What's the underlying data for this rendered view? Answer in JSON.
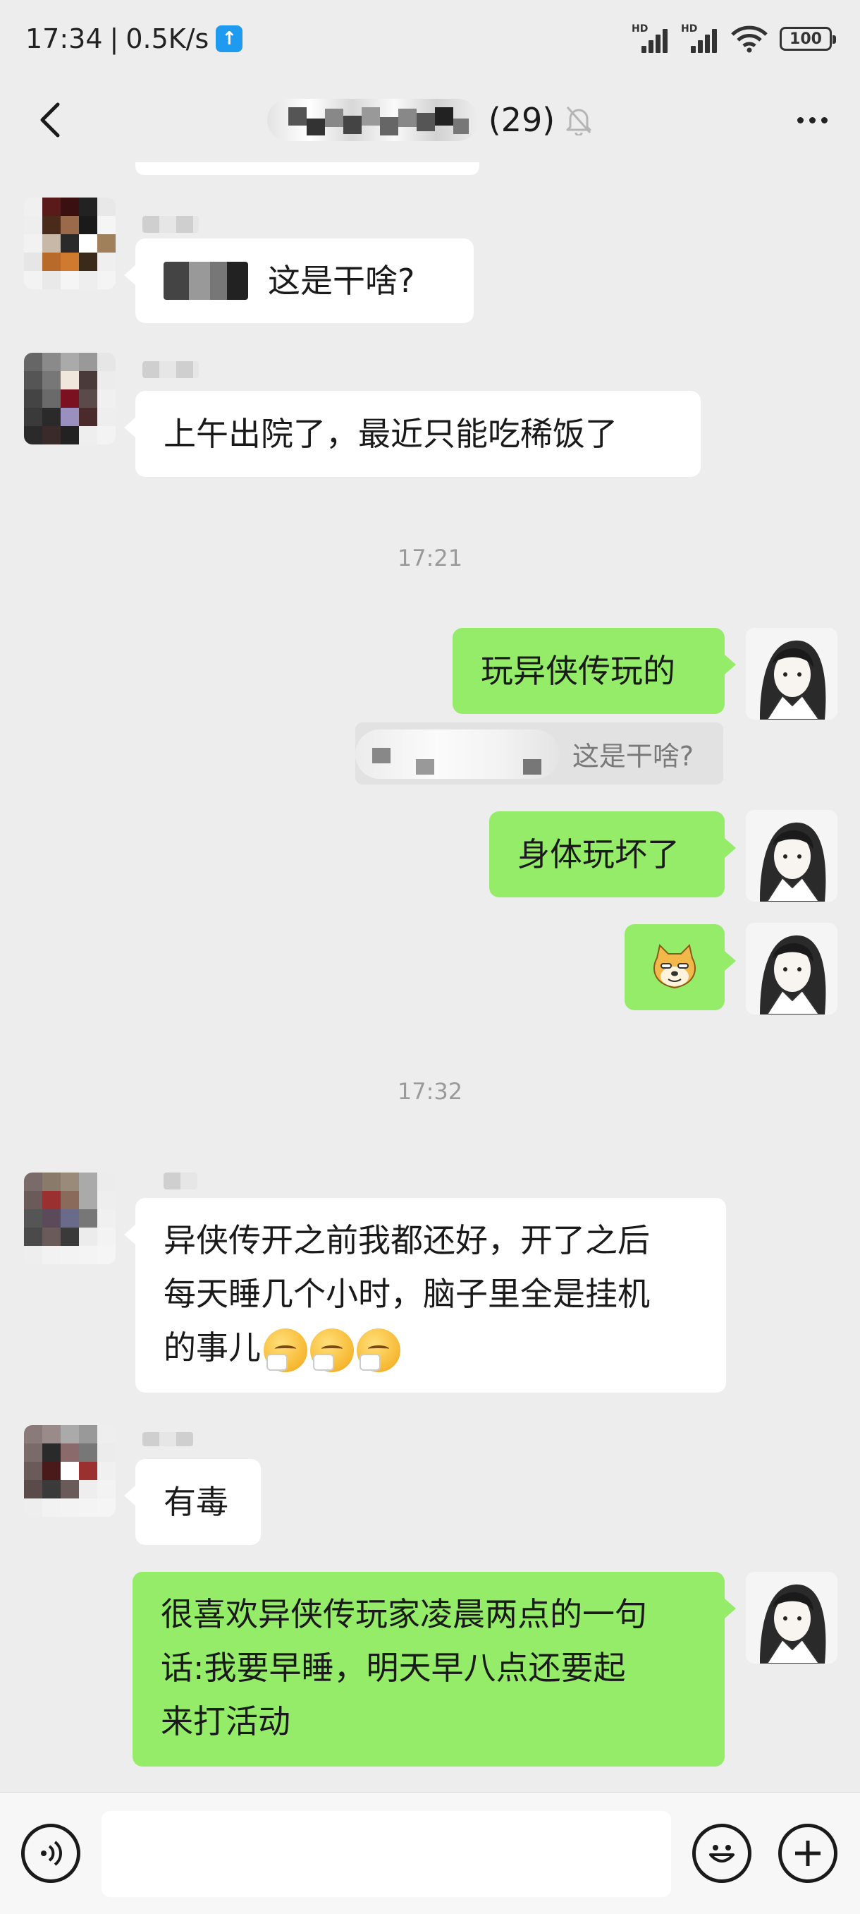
{
  "status_bar": {
    "time": "17:34",
    "speed": "0.5K/s",
    "battery": "100",
    "hd_label": "HD"
  },
  "header": {
    "member_count": "(29)",
    "back_icon": "chevron-left-icon",
    "mute_icon": "bell-off-icon",
    "more_icon": "more-dots-icon"
  },
  "messages": [
    {
      "side": "in",
      "text": "这是干啥?"
    },
    {
      "side": "in",
      "text": "上午出院了，最近只能吃稀饭了"
    },
    {
      "type": "time",
      "text": "17:21"
    },
    {
      "side": "out",
      "text": "玩异侠传玩的"
    },
    {
      "type": "quote",
      "text": "这是干啥?"
    },
    {
      "side": "out",
      "text": "身体玩坏了"
    },
    {
      "side": "out",
      "sticker": "doge-sticker"
    },
    {
      "type": "time",
      "text": "17:32"
    },
    {
      "side": "in",
      "lines": [
        "异侠传开之前我都还好，开了之后",
        "每天睡几个小时，脑子里全是挂机",
        "的事儿"
      ],
      "emoji": "yawn-emoji"
    },
    {
      "side": "in",
      "text": "有毒"
    },
    {
      "side": "out",
      "lines": [
        "很喜欢异侠传玩家凌晨两点的一句",
        "话:我要早睡，明天早八点还要起",
        "来打活动"
      ]
    }
  ],
  "input_bar": {
    "voice_icon": "voice-icon",
    "emoji_icon": "emoji-icon",
    "plus_icon": "plus-icon",
    "placeholder": ""
  }
}
